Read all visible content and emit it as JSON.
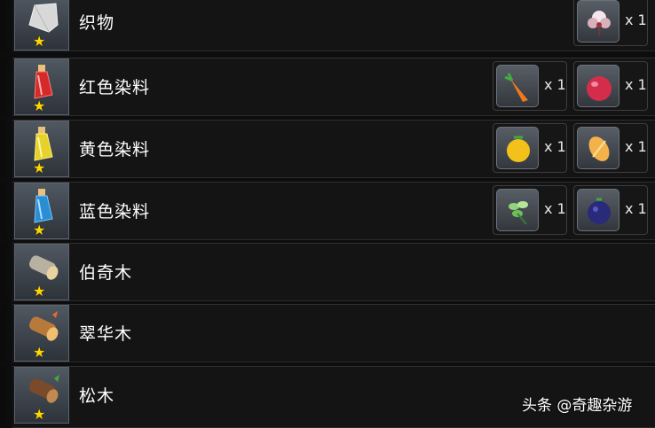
{
  "items": [
    {
      "name": "织物",
      "icon": "cloth-icon",
      "rarity_star": "★",
      "materials": [
        {
          "icon": "cotton-boll-icon",
          "qty": "x 1"
        }
      ]
    },
    {
      "name": "红色染料",
      "icon": "red-dye-bottle-icon",
      "rarity_star": "★",
      "materials": [
        {
          "icon": "carrot-icon",
          "qty": "x 1"
        },
        {
          "icon": "apple-icon",
          "qty": "x 1"
        }
      ]
    },
    {
      "name": "黄色染料",
      "icon": "yellow-dye-bottle-icon",
      "rarity_star": "★",
      "materials": [
        {
          "icon": "yellow-pepper-icon",
          "qty": "x 1"
        },
        {
          "icon": "wheat-icon",
          "qty": "x 1"
        }
      ]
    },
    {
      "name": "蓝色染料",
      "icon": "blue-dye-bottle-icon",
      "rarity_star": "★",
      "materials": [
        {
          "icon": "mint-leaf-icon",
          "qty": "x 1"
        },
        {
          "icon": "blueberry-icon",
          "qty": "x 1"
        }
      ]
    },
    {
      "name": "伯奇木",
      "icon": "birch-log-icon",
      "rarity_star": "★",
      "materials": []
    },
    {
      "name": "翠华木",
      "icon": "cuihua-log-icon",
      "rarity_star": "★",
      "materials": []
    },
    {
      "name": "松木",
      "icon": "pine-log-icon",
      "rarity_star": "★",
      "materials": []
    }
  ],
  "watermark": "头条 @奇趣杂游",
  "colors": {
    "star": "#ffd600",
    "row_bg": "#141414",
    "text": "#ffffff"
  }
}
